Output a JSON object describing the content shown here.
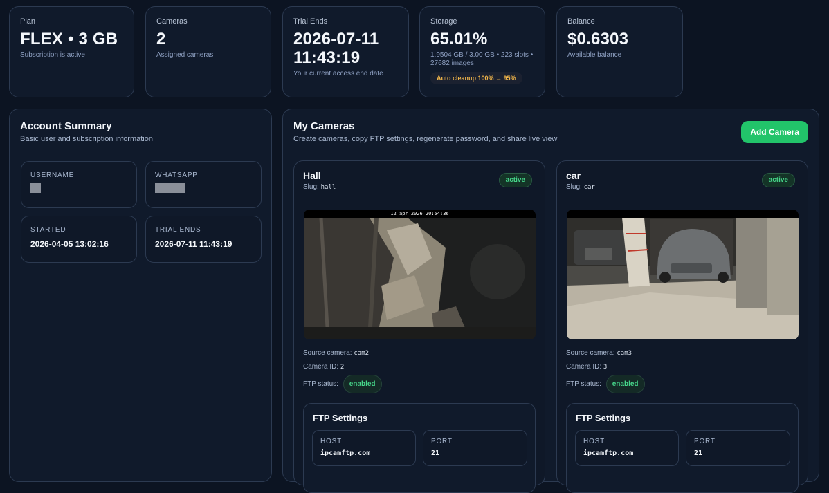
{
  "stats": [
    {
      "label": "Plan",
      "value": "FLEX • 3 GB",
      "sub": "Subscription is active"
    },
    {
      "label": "Cameras",
      "value": "2",
      "sub": "Assigned cameras"
    },
    {
      "label": "Trial Ends",
      "value": "2026-07-11 11:43:19",
      "sub": "Your current access end date"
    },
    {
      "label": "Storage",
      "value": "65.01%",
      "sub": "1.9504 GB / 3.00 GB • 223 slots • 27682 images",
      "badge": "Auto cleanup 100% → 95%"
    },
    {
      "label": "Balance",
      "value": "$0.6303",
      "sub": "Available balance"
    }
  ],
  "account": {
    "title": "Account Summary",
    "subtitle": "Basic user and subscription information",
    "username_label": "USERNAME",
    "whatsapp_label": "WHATSAPP",
    "started_label": "STARTED",
    "started_value": "2026-04-05 13:02:16",
    "trial_ends_label": "TRIAL ENDS",
    "trial_ends_value": "2026-07-11 11:43:19"
  },
  "cameras_panel": {
    "title": "My Cameras",
    "subtitle": "Create cameras, copy FTP settings, regenerate password, and share live view",
    "add_button": "Add Camera"
  },
  "cameras": [
    {
      "name": "Hall",
      "slug_label": "Slug:",
      "slug": "hall",
      "status": "active",
      "preview_timestamp": "12 apr 2026 20:54:36",
      "source_label": "Source camera:",
      "source": "cam2",
      "id_label": "Camera ID:",
      "id": "2",
      "ftp_status_label": "FTP status:",
      "ftp_status": "enabled",
      "ftp_title": "FTP Settings",
      "host_label": "HOST",
      "host": "ipcamftp.com",
      "port_label": "PORT",
      "port": "21"
    },
    {
      "name": "car",
      "slug_label": "Slug:",
      "slug": "car",
      "status": "active",
      "preview_timestamp": "",
      "source_label": "Source camera:",
      "source": "cam3",
      "id_label": "Camera ID:",
      "id": "3",
      "ftp_status_label": "FTP status:",
      "ftp_status": "enabled",
      "ftp_title": "FTP Settings",
      "host_label": "HOST",
      "host": "ipcamftp.com",
      "port_label": "PORT",
      "port": "21"
    }
  ],
  "colors": {
    "background": "#0c1422",
    "card": "#101a2b",
    "accent_green": "#22c46a",
    "status_green": "#46d68a",
    "warning": "#f0b54a"
  }
}
